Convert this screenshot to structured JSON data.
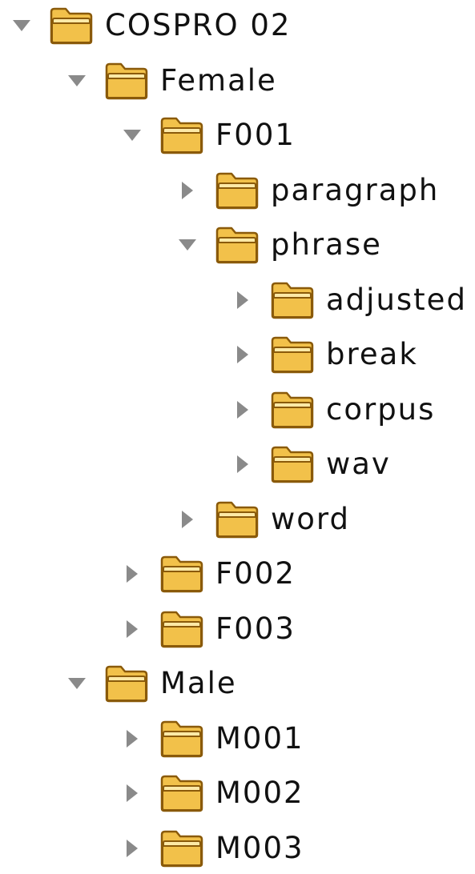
{
  "tree": {
    "nodes": [
      {
        "name": "COSPRO 02",
        "depth": 0,
        "expanded": true,
        "icon": "folder-icon"
      },
      {
        "name": "Female",
        "depth": 1,
        "expanded": true,
        "icon": "folder-icon"
      },
      {
        "name": "F001",
        "depth": 2,
        "expanded": true,
        "icon": "folder-icon"
      },
      {
        "name": "paragraph",
        "depth": 3,
        "expanded": false,
        "icon": "folder-icon"
      },
      {
        "name": "phrase",
        "depth": 3,
        "expanded": true,
        "icon": "folder-icon"
      },
      {
        "name": "adjusted",
        "depth": 4,
        "expanded": false,
        "icon": "folder-icon"
      },
      {
        "name": "break",
        "depth": 4,
        "expanded": false,
        "icon": "folder-icon"
      },
      {
        "name": "corpus",
        "depth": 4,
        "expanded": false,
        "icon": "folder-icon"
      },
      {
        "name": "wav",
        "depth": 4,
        "expanded": false,
        "icon": "folder-icon"
      },
      {
        "name": "word",
        "depth": 3,
        "expanded": false,
        "icon": "folder-icon"
      },
      {
        "name": "F002",
        "depth": 2,
        "expanded": false,
        "icon": "folder-icon"
      },
      {
        "name": "F003",
        "depth": 2,
        "expanded": false,
        "icon": "folder-icon"
      },
      {
        "name": "Male",
        "depth": 1,
        "expanded": true,
        "icon": "folder-icon"
      },
      {
        "name": "M001",
        "depth": 2,
        "expanded": false,
        "icon": "folder-icon"
      },
      {
        "name": "M002",
        "depth": 2,
        "expanded": false,
        "icon": "folder-icon"
      },
      {
        "name": "M003",
        "depth": 2,
        "expanded": false,
        "icon": "folder-icon"
      }
    ]
  },
  "colors": {
    "toggle": "#8a8a8a",
    "folder_body": "#f2c14a",
    "folder_light": "#fde9a6",
    "folder_outline": "#8a5a0a",
    "text": "#111111"
  }
}
